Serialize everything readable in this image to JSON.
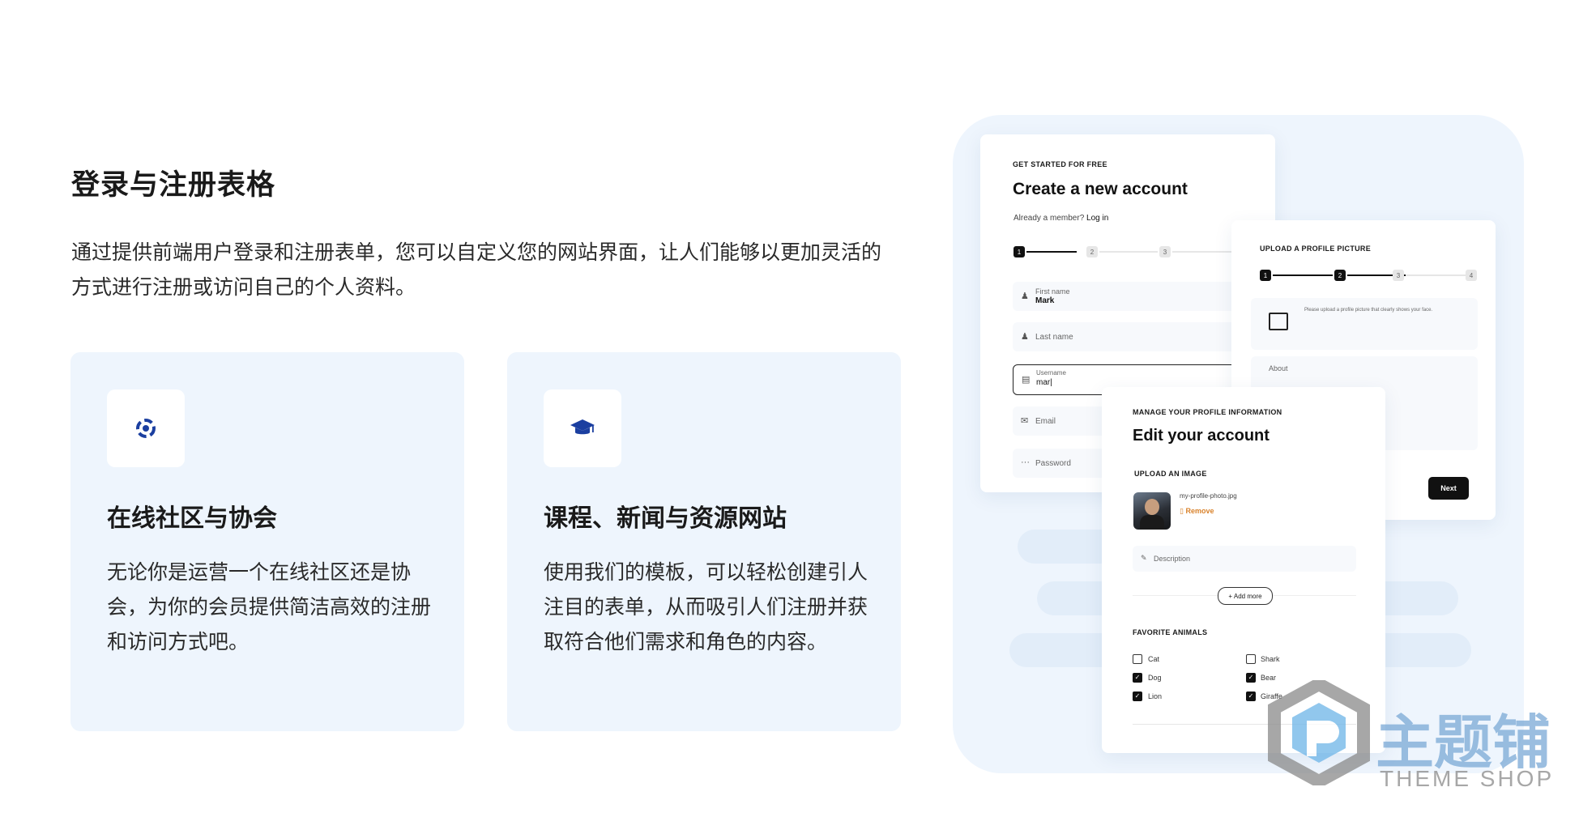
{
  "hero": {
    "title": "登录与注册表格",
    "description": "通过提供前端用户登录和注册表单，您可以自定义您的网站界面，让人们能够以更加灵活的方式进行注册或访问自己的个人资料。"
  },
  "features": [
    {
      "icon": "community-icon",
      "title": "在线社区与协会",
      "text": "无论你是运营一个在线社区还是协会，为你的会员提供简洁高效的注册和访问方式吧。"
    },
    {
      "icon": "graduation-cap-icon",
      "title": "课程、新闻与资源网站",
      "text": "使用我们的模板，可以轻松创建引人注目的表单，从而吸引人们注册并获取符合他们需求和角色的内容。"
    }
  ],
  "signup": {
    "eyebrow": "GET STARTED FOR FREE",
    "heading": "Create a new account",
    "member_text": "Already a member?",
    "login_link": "Log in",
    "steps": [
      "1",
      "2",
      "3"
    ],
    "fields": {
      "first_name_label": "First name",
      "first_name_value": "Mark",
      "last_name_placeholder": "Last name",
      "username_label": "Username",
      "username_value": "mar|",
      "email_placeholder": "Email",
      "password_placeholder": "Password"
    }
  },
  "upload_panel": {
    "eyebrow": "UPLOAD A PROFILE PICTURE",
    "steps": [
      "1",
      "2",
      "3",
      "4"
    ],
    "hint": "Please upload a profile picture that clearly shows your face.",
    "about_placeholder": "About",
    "next_label": "Next"
  },
  "edit_panel": {
    "eyebrow": "MANAGE YOUR PROFILE INFORMATION",
    "heading": "Edit your account",
    "upload_label": "UPLOAD AN IMAGE",
    "filename": "my-profile-photo.jpg",
    "remove_label": "Remove",
    "description_placeholder": "Description",
    "add_more_label": "+ Add more",
    "animals_label": "FAVORITE ANIMALS",
    "animals": [
      {
        "name": "Cat",
        "checked": false
      },
      {
        "name": "Shark",
        "checked": false
      },
      {
        "name": "Dog",
        "checked": true
      },
      {
        "name": "Bear",
        "checked": true
      },
      {
        "name": "Lion",
        "checked": true
      },
      {
        "name": "Giraffe",
        "checked": true
      }
    ]
  },
  "watermark": {
    "brand": "主题铺",
    "sub": "THEME SHOP"
  },
  "colors": {
    "accent_blue": "#1b3fa0",
    "card_bg": "#eef5fd",
    "remove_orange": "#d9822b"
  }
}
